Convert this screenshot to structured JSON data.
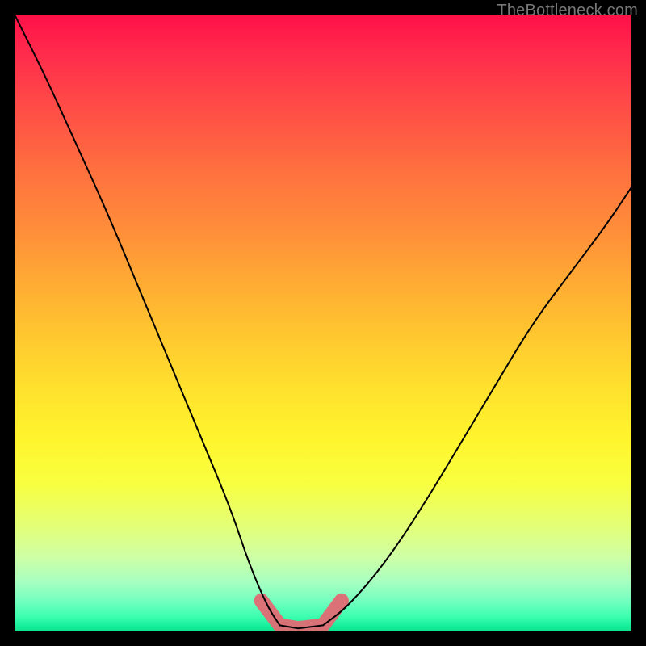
{
  "watermark": {
    "text": "TheBottleneck.com"
  },
  "colors": {
    "frame_bg": "#000000",
    "curve_stroke": "#000000",
    "accent_stroke": "#e16a74",
    "gradient_top": "#ff1048",
    "gradient_bottom": "#0ce28f"
  },
  "chart_data": {
    "type": "line",
    "title": "",
    "xlabel": "",
    "ylabel": "",
    "xlim": [
      0,
      100
    ],
    "ylim": [
      0,
      100
    ],
    "grid": false,
    "legend": false,
    "notes": "Background is a vertical red→yellow→green gradient. A V-shaped bottleneck curve dips to ~0 near x≈42–50 then rises again. Pink accent segment marks the flat bottom region.",
    "series": [
      {
        "name": "bottleneck-curve-left",
        "x": [
          0,
          5,
          10,
          15,
          20,
          25,
          30,
          35,
          38,
          41,
          43
        ],
        "y": [
          100,
          90,
          79,
          68,
          56,
          44,
          32,
          20,
          11,
          4,
          1
        ]
      },
      {
        "name": "bottleneck-curve-bottom",
        "x": [
          43,
          46,
          50
        ],
        "y": [
          1,
          0.5,
          1
        ]
      },
      {
        "name": "bottleneck-curve-right",
        "x": [
          50,
          54,
          60,
          66,
          72,
          78,
          84,
          90,
          96,
          100
        ],
        "y": [
          1,
          4,
          11,
          20,
          30,
          40,
          50,
          58,
          66,
          72
        ]
      }
    ],
    "accent_region": {
      "name": "optimal-range-marker",
      "x": [
        40,
        43,
        46,
        50,
        53
      ],
      "y": [
        5,
        1,
        0.5,
        1,
        5
      ]
    }
  }
}
